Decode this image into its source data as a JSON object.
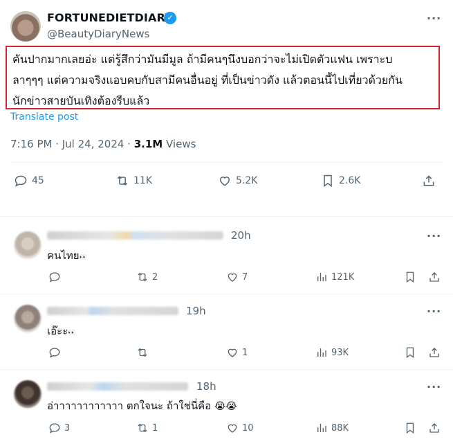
{
  "tweet": {
    "display_name": "FORTUNEDIETDIARY",
    "handle": "@BeautyDiaryNews",
    "lines": [
      "คันปากมากเลยอ่ะ แต่รู้สึกว่ามันมีมูล ถ้ามีคนๆนึงบอกว่าจะไม่เปิดตัวแฟน เพราะบ",
      "ลาๆๆๆ แต่ความจริงแอบคบกับสามีคนอื่นอยู่ ที่เป็นข่าวดัง แล้วตอนนี้ไปเที่ยวด้วยกัน",
      "นักข่าวสายบันเทิงต้องรีบแล้ว"
    ],
    "translate": "Translate post",
    "time": "7:16 PM · Jul 24, 2024 · ",
    "views_count": "3.1M",
    "views_label": " Views",
    "stats": {
      "replies": "45",
      "reposts": "11K",
      "likes": "5.2K",
      "bookmarks": "2.6K"
    }
  },
  "replies": [
    {
      "time": "20h",
      "text": "คนไทย",
      "emoji": "👀",
      "reply_count": "",
      "repost_count": "2",
      "like_count": "7",
      "view_count": "121K"
    },
    {
      "time": "19h",
      "text": "เอ๊ะะ",
      "emoji": "👀",
      "reply_count": "",
      "repost_count": "",
      "like_count": "1",
      "view_count": "93K"
    },
    {
      "time": "18h",
      "text": "อ่าาาาาาาาาาาา ตกใจนะ ถ้าใช่นี่คือ",
      "emoji": "😭😭",
      "reply_count": "3",
      "repost_count": "1",
      "like_count": "10",
      "view_count": "88K"
    }
  ],
  "icons": [
    "verified-badge-icon",
    "more-icon",
    "reply-icon",
    "repost-icon",
    "like-icon",
    "bookmark-icon",
    "share-icon",
    "views-icon"
  ],
  "colors": {
    "accent": "#1d9bf0",
    "highlight_border": "#d9232e",
    "muted": "#536471"
  }
}
